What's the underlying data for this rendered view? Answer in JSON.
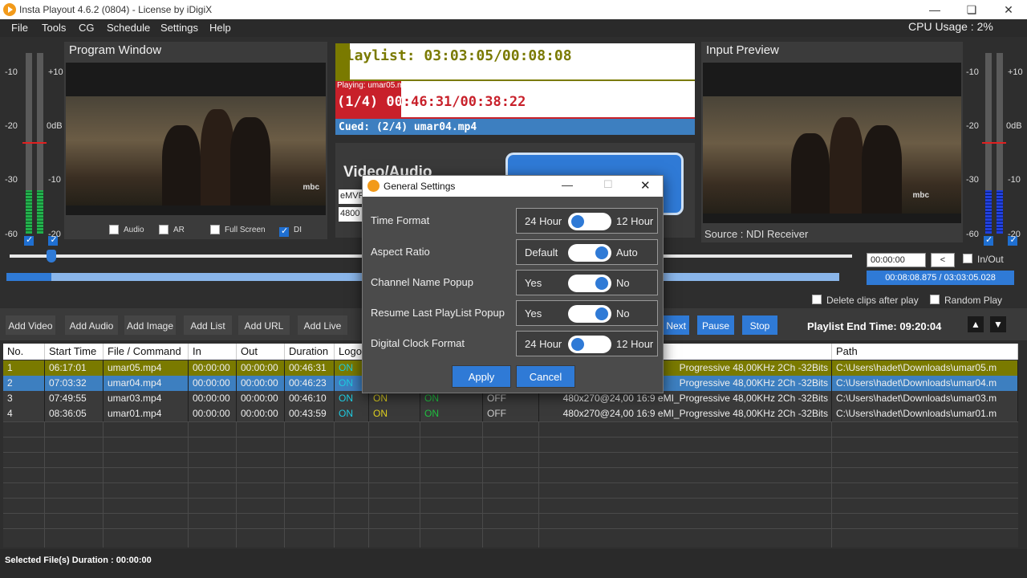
{
  "window": {
    "title": "Insta Playout 4.6.2 (0804) - License by iDigiX",
    "cpu": "CPU Usage : 2%"
  },
  "menu": [
    "File",
    "Tools",
    "CG",
    "Schedule",
    "Settings",
    "Help"
  ],
  "meters": {
    "left_labels": [
      "-10",
      "-20",
      "-30",
      "-60"
    ],
    "mid_labels": [
      "+10",
      "0dB",
      "-10",
      "-20"
    ],
    "right_labels": [
      "-10",
      "-20",
      "-30",
      "-60"
    ],
    "right_mid_labels": [
      "+10",
      "0dB",
      "-10",
      "-20"
    ]
  },
  "program": {
    "title": "Program Window",
    "watermark": "mbc",
    "options": [
      "Audio",
      "AR",
      "Full Screen",
      "DI"
    ]
  },
  "input_preview": {
    "title": "Input Preview",
    "watermark": "mbc",
    "source": "Source : NDI Receiver"
  },
  "playlist_status": {
    "playlist_time": "Playlist: 03:03:05/00:08:08",
    "playing_label": "Playing: umar05.mp4",
    "playing_time": "(1/4) 00:46:31/00:38:22",
    "cued": "Cued: (2/4) umar04.mp4"
  },
  "video_audio": {
    "title": "Video/Audio",
    "line1": "eMVF",
    "line2": "4800"
  },
  "seek": {
    "time_input": "00:00:00",
    "prev": "<",
    "inout": "In/Out",
    "position": "00:08:08.875 / 03:03:05.028"
  },
  "options": {
    "delete_clips": "Delete clips after play",
    "random_play": "Random Play"
  },
  "toolbar": {
    "buttons": [
      "Add Video",
      "Add Audio",
      "Add Image",
      "Add List",
      "Add URL",
      "Add Live"
    ],
    "next": "Next",
    "pause": "Pause",
    "stop": "Stop",
    "end_time": "Playlist End Time: 09:20:04"
  },
  "table": {
    "headers": [
      "No.",
      "Start Time",
      "File / Command",
      "In",
      "Out",
      "Duration",
      "Logo",
      "",
      "",
      "",
      "",
      "Path"
    ],
    "rows": [
      {
        "no": "1",
        "start": "06:17:01",
        "file": "umar05.mp4",
        "in": "00:00:00",
        "out": "00:00:00",
        "dur": "00:46:31",
        "logo": "ON",
        "c2": "",
        "c3": "",
        "c4": "",
        "info": "Progressive 48,00KHz 2Ch -32Bits",
        "path": "C:\\Users\\hadet\\Downloads\\umar05.m"
      },
      {
        "no": "2",
        "start": "07:03:32",
        "file": "umar04.mp4",
        "in": "00:00:00",
        "out": "00:00:00",
        "dur": "00:46:23",
        "logo": "ON",
        "c2": "",
        "c3": "",
        "c4": "",
        "info": "Progressive 48,00KHz 2Ch -32Bits",
        "path": "C:\\Users\\hadet\\Downloads\\umar04.m"
      },
      {
        "no": "3",
        "start": "07:49:55",
        "file": "umar03.mp4",
        "in": "00:00:00",
        "out": "00:00:00",
        "dur": "00:46:10",
        "logo": "ON",
        "c2": "ON",
        "c3": "ON",
        "c4": "OFF",
        "info": "480x270@24,00 16:9 eMI_Progressive 48,00KHz 2Ch -32Bits",
        "path": "C:\\Users\\hadet\\Downloads\\umar03.m"
      },
      {
        "no": "4",
        "start": "08:36:05",
        "file": "umar01.mp4",
        "in": "00:00:00",
        "out": "00:00:00",
        "dur": "00:43:59",
        "logo": "ON",
        "c2": "ON",
        "c3": "ON",
        "c4": "OFF",
        "info": "480x270@24,00 16:9 eMI_Progressive 48,00KHz 2Ch -32Bits",
        "path": "C:\\Users\\hadet\\Downloads\\umar01.m"
      }
    ]
  },
  "status": {
    "selected_duration": "Selected File(s) Duration : 00:00:00"
  },
  "dialog": {
    "title": "General Settings",
    "settings": [
      {
        "label": "Time Format",
        "left": "24 Hour",
        "right": "12 Hour",
        "state": "left"
      },
      {
        "label": "Aspect Ratio",
        "left": "Default",
        "right": "Auto",
        "state": "right"
      },
      {
        "label": "Channel Name Popup",
        "left": "Yes",
        "right": "No",
        "state": "right"
      },
      {
        "label": "Resume Last PlayList Popup",
        "left": "Yes",
        "right": "No",
        "state": "right"
      },
      {
        "label": "Digital Clock Format",
        "left": "24 Hour",
        "right": "12 Hour",
        "state": "left"
      }
    ],
    "apply": "Apply",
    "cancel": "Cancel"
  },
  "colors": {
    "accent": "#2f7ad6",
    "row1": "#7a7a00",
    "row2": "#3d7fc0",
    "on_cyan": "#1ecbe1",
    "on_yellow": "#e0d020",
    "on_green": "#20c040",
    "playing_red": "#c8202a"
  }
}
